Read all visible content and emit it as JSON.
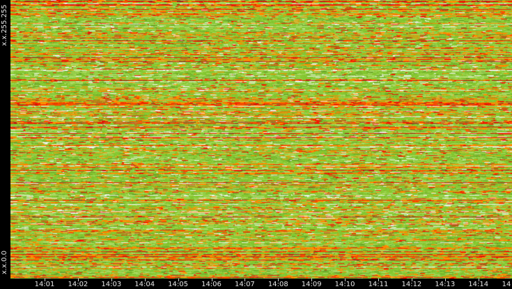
{
  "chart_data": {
    "type": "heatmap",
    "title": "",
    "xlabel": "",
    "ylabel": "",
    "y_tick_labels": [
      "x.x.255.255",
      "x.x.0.0"
    ],
    "x_ticks": [
      "14:01",
      "14:02",
      "14:03",
      "14:04",
      "14:05",
      "14:06",
      "14:07",
      "14:08",
      "14:09",
      "14:10",
      "14:11",
      "14:12",
      "14:13",
      "14:14",
      "14"
    ],
    "x_range": [
      "14:00",
      "14:15"
    ],
    "y_range": [
      "x.x.0.0",
      "x.x.255.255"
    ],
    "grid": false,
    "legend": "none",
    "color_scale": [
      "#ffffff",
      "#a8d860",
      "#86c832",
      "#6aa52a",
      "#e8a000",
      "#ff8c00",
      "#ff3300",
      "#dd0000",
      "#b01818"
    ],
    "background": "#000000"
  }
}
